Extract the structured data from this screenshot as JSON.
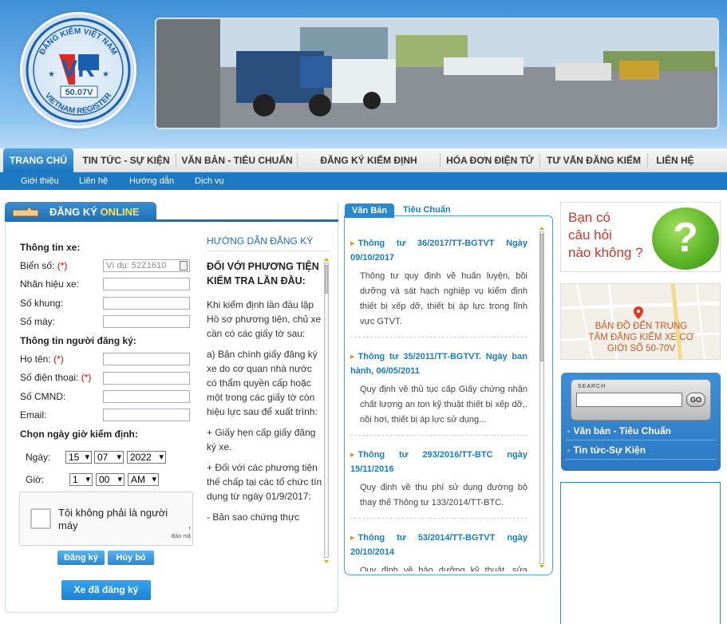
{
  "logo": {
    "top_text": "ĐĂNG KIỂM VIỆT NAM",
    "bottom_text": "VIETNAM REGISTER",
    "mark": "VR",
    "code": "50.07V"
  },
  "nav": {
    "items": [
      {
        "label": "TRANG CHỦ"
      },
      {
        "label": "TIN TỨC - SỰ KIỆN"
      },
      {
        "label": "VĂN BẢN - TIÊU CHUẨN"
      },
      {
        "label": "ĐĂNG KÝ KIỂM ĐỊNH TRƯỚC"
      },
      {
        "label": "HÓA ĐƠN ĐIỆN TỬ"
      },
      {
        "label": "TƯ VẤN ĐĂNG KIỂM"
      },
      {
        "label": "LIÊN HỆ"
      }
    ],
    "subitems": [
      {
        "label": "Giới thiệu"
      },
      {
        "label": "Liên hệ"
      },
      {
        "label": "Hướng dẫn"
      },
      {
        "label": "Dịch vụ"
      }
    ]
  },
  "registration": {
    "tab_label": "ĐĂNG KÝ ",
    "tab_label_highlight": "ONLINE",
    "vehicle_section": "Thông tin xe:",
    "plate_label": "Biển số:",
    "plate_required": "(*)",
    "plate_placeholder": "Ví dụ: 52Z1610",
    "brand_label": "Nhãn hiệu xe:",
    "chassis_label": "Số khung:",
    "engine_label": "Số máy:",
    "owner_section": "Thông tin người đăng ký:",
    "name_label": "Họ tên:",
    "name_required": "(*)",
    "phone_label": "Số điện thoại:",
    "phone_required": "(*)",
    "id_label": "Số CMND:",
    "email_label": "Email:",
    "date_section": "Chọn ngày giờ kiểm định:",
    "day_label": "Ngày:",
    "day_value": "15",
    "month_value": "07",
    "year_value": "2022",
    "time_label": "Giờ:",
    "hour_value": "1",
    "minute_value": "00",
    "ampm_value": "AM",
    "captcha_text": "Tôi không phải là người máy",
    "captcha_r": "r",
    "captcha_privacy": "Bảo mậ",
    "register_button": "Đăng ký",
    "cancel_button": "Hủy bỏ",
    "registered_button": "Xe đã đăng ký"
  },
  "guide": {
    "title": "HƯỚNG DẪN ĐĂNG KÝ",
    "heading": "ĐỐI VỚI PHƯƠNG TIỆN  KIỂM TRA LẦN ĐẦU:",
    "p1": "Khi kiểm định lần đầu lập Hồ sơ phương tiện, chủ xe cần có các giấy tờ sau:",
    "p2": "a)      Bản chính giấy đăng ký xe do cơ quan nhà nước có thẩm quyền cấp hoặc một trong các giấy tờ còn hiệu lực sau để xuất trình:",
    "p3": "+ Giấy hẹn cấp giấy đăng ký xe.",
    "p4": "+ Đối với các phương tiện thế chấp tại các tổ chức tín dụng từ ngày 01/9/2017:",
    "p5": "- Bản sao chứng thực"
  },
  "documents": {
    "tab_active": "Văn Bản",
    "tab_inactive": "Tiêu Chuẩn",
    "items": [
      {
        "title": "Thông tư 36/2017/TT-BGTVT Ngày 09/10/2017",
        "desc": "Thông tư quy định về huấn luyện, bồi dưỡng và sát hạch nghiệp vụ kiểm định thiết bị xếp dỡ, thiết bị áp lực trong lĩnh vực GTVT."
      },
      {
        "title": "Thông tư 35/2011/TT-BGTVT. Ngày ban hành, 06/05/2011",
        "desc": "Quy định về thủ tục cấp Giấy chứng nhận chất lượng an ton kỹ thuật thiết bị xếp dỡ,. nồi hơi, thiết bị áp lực sử dụng..."
      },
      {
        "title": "Thông tư 293/2016/TT-BTC ngày 15/11/2016",
        "desc": "Quy định về thu phí sử dụng đường bộ thay thế Thông tư 133/2014/TT-BTC."
      },
      {
        "title": "Thông tư 53/2014/TT-BGTVT ngày 20/10/2014",
        "desc": "Quy định về bảo dưỡng kỹ thuật, sửa chữa phương tiện giao thông cơ giới đường bộ"
      }
    ]
  },
  "sidebar": {
    "faq_text_1": "Bạn có",
    "faq_text_2": "câu hỏi",
    "faq_text_3": "nào không ?",
    "faq_symbol": "?",
    "map_text_1": "BẢN ĐỒ ĐẾN TRUNG",
    "map_text_2": "TÂM ĐĂNG KIỂM XE CƠ",
    "map_text_3": "GIỚI SỐ 50-70V",
    "search_label": "SEARCH",
    "search_go": "GO",
    "link_1": "Văn bản - Tiêu Chuẩn",
    "link_2": "Tin tức-Sự Kiện"
  }
}
